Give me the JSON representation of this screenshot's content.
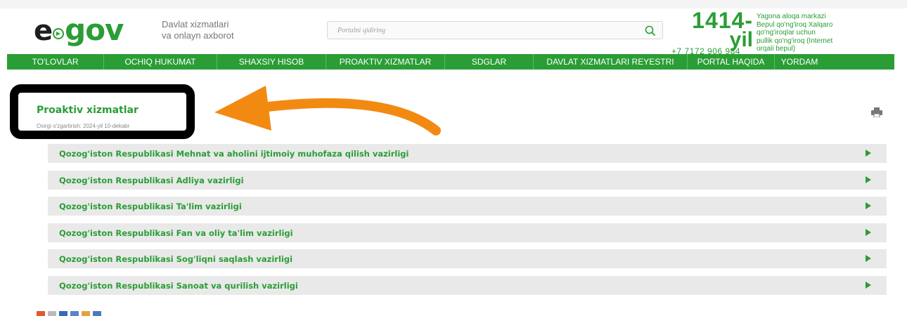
{
  "header": {
    "logo": {
      "e": "e",
      "gov": "gov"
    },
    "tagline_line1": "Davlat xizmatlari",
    "tagline_line2": "va onlayn axborot",
    "search": {
      "placeholder": "Portalni qidiring"
    },
    "hotline": {
      "number": "1414-",
      "suffix": "yil",
      "phone": "+7 7172 906 984"
    },
    "callinfo": {
      "line1": "Yagona aloqa markazi",
      "line2": "Bepul qo'ng'iroq Xalqaro",
      "line3": "qo'ng'iroqlar uchun",
      "line4": "pullik qo'ng'iroq (Internet",
      "line5": "orqali bepul)"
    }
  },
  "nav": {
    "items": [
      {
        "label": "TO'LOVLAR"
      },
      {
        "label": "OCHIQ HUKUMAT"
      },
      {
        "label": "SHAXSIY HISOB"
      },
      {
        "label": "PROAKTIV XIZMATLAR"
      },
      {
        "label": "SDGLAR"
      },
      {
        "label": "DAVLAT XIZMATLARI REYESTRI"
      },
      {
        "label": "PORTAL HAQIDA"
      },
      {
        "label": "YORDAM"
      }
    ]
  },
  "page": {
    "title": "Proaktiv xizmatlar",
    "modified": "Oxirgi o'zgartirish: 2024-yil 10-dekabr"
  },
  "accordion": {
    "items": [
      {
        "label": "Qozog'iston Respublikasi Mehnat va aholini ijtimoiy muhofaza qilish vazirligi"
      },
      {
        "label": "Qozog'iston Respublikasi Adliya vazirligi"
      },
      {
        "label": "Qozog'iston Respublikasi Ta'lim vazirligi"
      },
      {
        "label": "Qozog'iston Respublikasi Fan va oliy ta'lim vazirligi"
      },
      {
        "label": "Qozog'iston Respublikasi Sog'liqni saqlash vazirligi"
      },
      {
        "label": "Qozog'iston Respublikasi Sanoat va qurilish vazirligi"
      }
    ]
  },
  "colors": {
    "brand_green": "#2a9d35",
    "annotation_arrow": "#f28a12",
    "annotation_box": "#000000"
  },
  "icons": {
    "search": "search-icon",
    "print": "printer-icon",
    "expand": "triangle-right-icon"
  }
}
